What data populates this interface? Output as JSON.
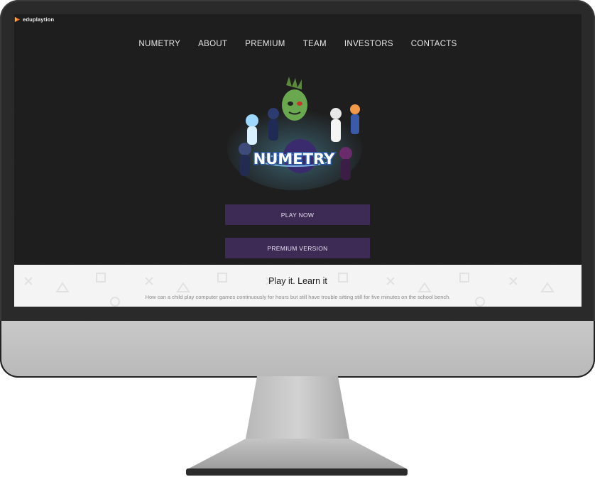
{
  "brand": {
    "name": "eduplaytion",
    "icon": "play-arrow-icon",
    "accent": "#f06a2a"
  },
  "nav": {
    "items": [
      {
        "label": "NUMETRY"
      },
      {
        "label": "ABOUT"
      },
      {
        "label": "PREMIUM"
      },
      {
        "label": "TEAM"
      },
      {
        "label": "INVESTORS"
      },
      {
        "label": "CONTACTS"
      }
    ]
  },
  "hero": {
    "logo_text": "NUMETRY"
  },
  "buttons": {
    "play_now": "PLAY NOW",
    "premium_version": "PREMIUM VERSION",
    "color": "#3d2a55"
  },
  "band": {
    "title": "Play it. Learn it",
    "text": "How can a child play computer games continuously for hours but still have trouble sitting still for five minutes on the school bench."
  }
}
